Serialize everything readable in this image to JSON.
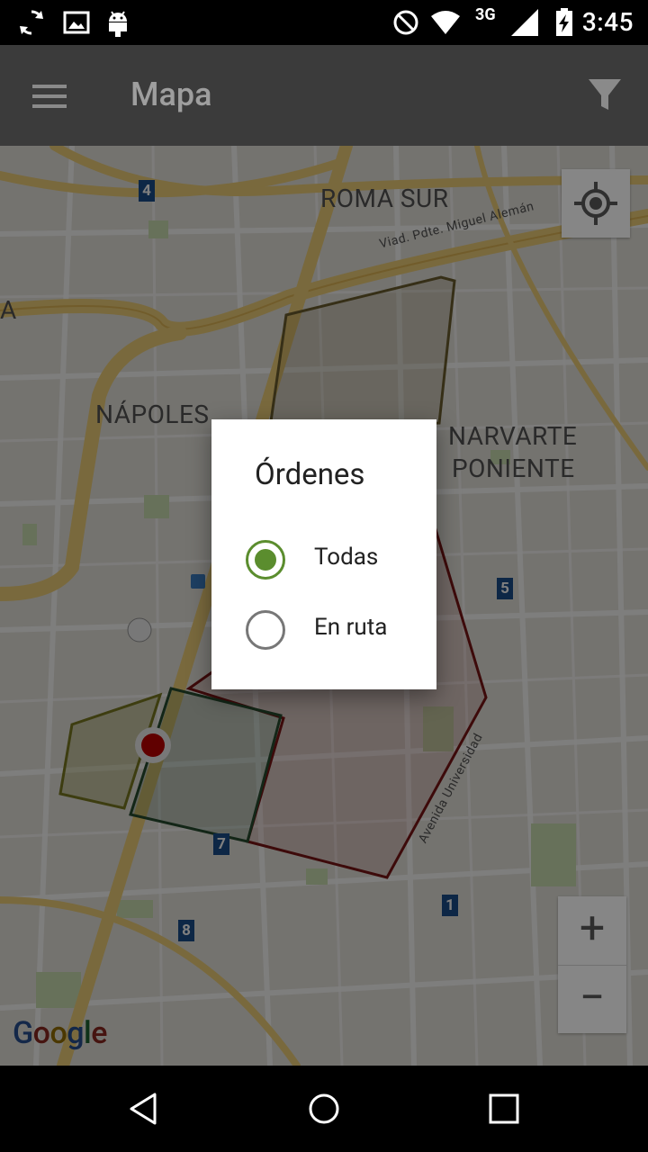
{
  "status_bar": {
    "time": "3:45",
    "network": "3G",
    "icons": [
      "sync-icon",
      "image-icon",
      "android-icon",
      "do-not-disturb-icon",
      "wifi-icon",
      "signal-icon",
      "battery-charging-icon"
    ]
  },
  "app_bar": {
    "title": "Mapa",
    "menu_icon": "menu-icon",
    "filter_icon": "filter-icon"
  },
  "map": {
    "labels": {
      "roma_sur": "ROMA SUR",
      "napoles": "NÁPOLES",
      "narvarte": "NARVARTE",
      "poniente": "PONIENTE",
      "viaducto": "Viad. Pdte. Miguel Alemán",
      "avenida": "Avenida Universidad",
      "left_a": "A"
    },
    "route_shields": [
      "4",
      "5",
      "7",
      "8",
      "1"
    ],
    "zoom_in": "+",
    "zoom_out": "−",
    "attribution": "Google",
    "colors": {
      "road": "#f3d37a",
      "block": "#f4f1ea",
      "park": "#c8dfb0",
      "zone_red": "#8b1a1a",
      "zone_green": "#2e5d3a",
      "zone_olive": "#8a8a2e",
      "zone_brown": "#7a6a3a"
    }
  },
  "dialog": {
    "title": "Órdenes",
    "options": [
      {
        "label": "Todas",
        "selected": true
      },
      {
        "label": "En ruta",
        "selected": false
      }
    ],
    "accent": "#5b8d2e"
  },
  "nav_bar": {
    "icons": [
      "back-icon",
      "home-icon",
      "recents-icon"
    ]
  }
}
